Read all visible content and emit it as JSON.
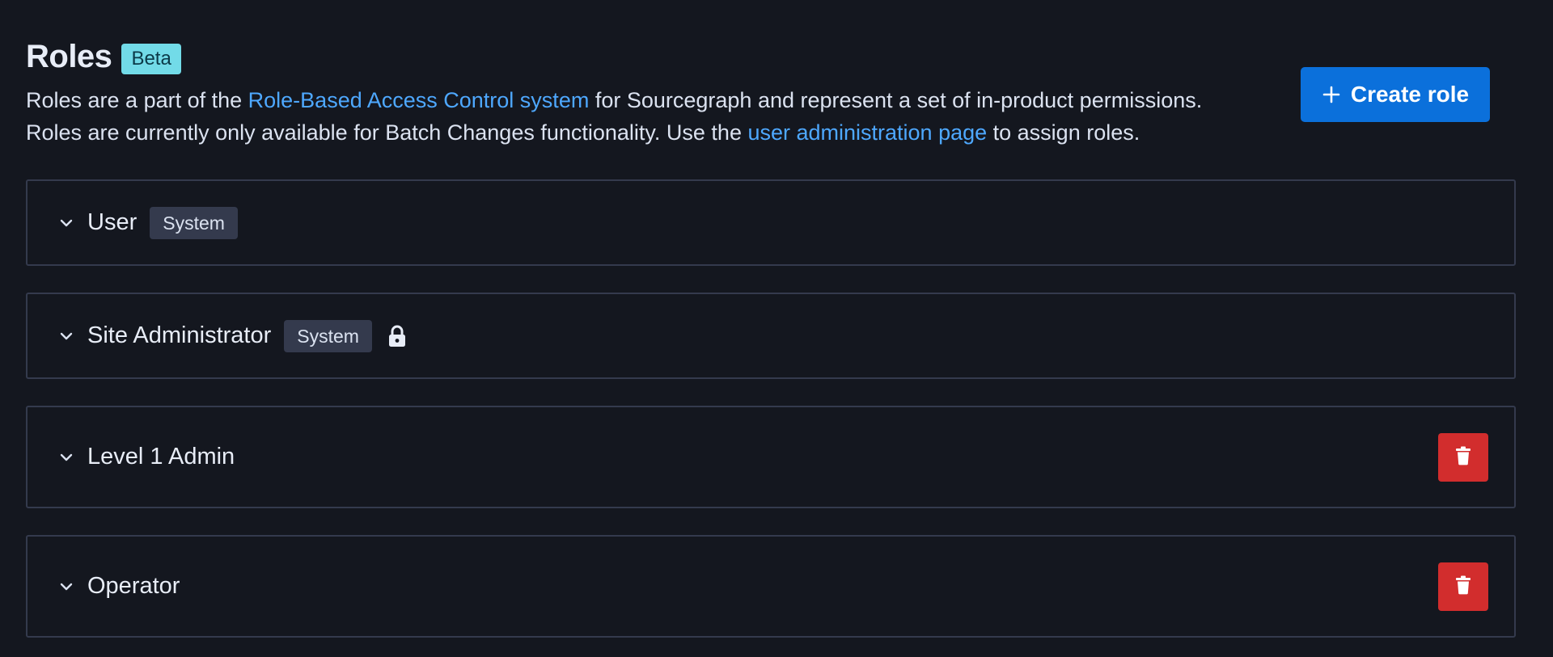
{
  "header": {
    "title": "Roles",
    "beta_badge": "Beta",
    "description": {
      "line1_before": "Roles are a part of the ",
      "line1_link": "Role-Based Access Control system",
      "line1_after": " for Sourcegraph and represent a set of in-product permissions.",
      "line2_before": "Roles are currently only available for Batch Changes functionality. Use the ",
      "line2_link": "user administration page",
      "line2_after": " to assign roles."
    },
    "create_button_label": "Create role"
  },
  "roles": [
    {
      "name": "User",
      "badge": "System",
      "locked": false,
      "deletable": false
    },
    {
      "name": "Site Administrator",
      "badge": "System",
      "locked": true,
      "deletable": false
    },
    {
      "name": "Level 1 Admin",
      "badge": "",
      "locked": false,
      "deletable": true
    },
    {
      "name": "Operator",
      "badge": "",
      "locked": false,
      "deletable": true
    }
  ],
  "colors": {
    "background": "#14171f",
    "primary": "#0b70db",
    "danger": "#d22d2d",
    "link": "#4ea8ff",
    "beta_badge": "#72dbe8",
    "system_badge": "#343a4d",
    "border": "#343a4d"
  },
  "icons": {
    "create": "plus-icon",
    "expand": "chevron-down-icon",
    "lock": "lock-icon",
    "delete": "trash-icon"
  }
}
